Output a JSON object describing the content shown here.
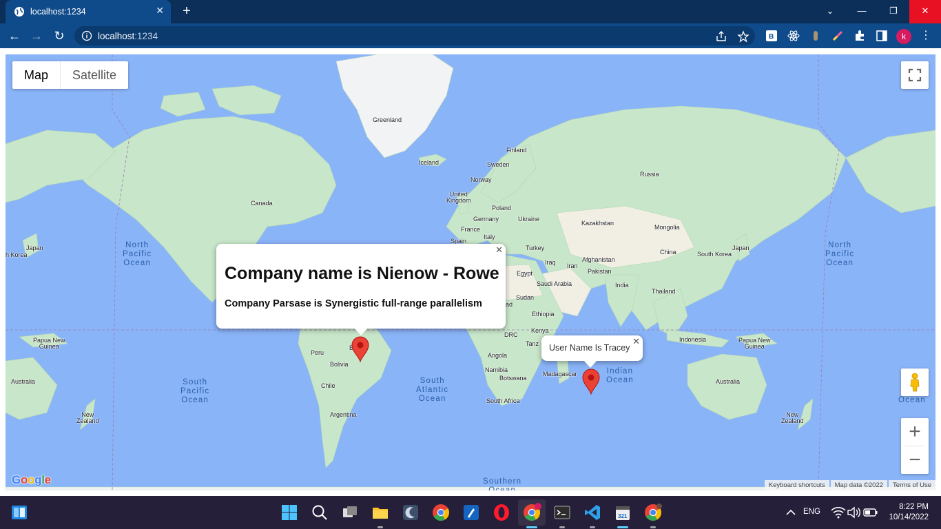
{
  "browser": {
    "tab_title": "localhost:1234",
    "url_host": "localhost",
    "url_port": ":1234",
    "profile_initial": "k"
  },
  "map": {
    "map_type_options": [
      "Map",
      "Satellite"
    ],
    "selected_map_type": "Map",
    "google_logo": "Google",
    "attribution": {
      "keyboard_shortcuts": "Keyboard shortcuts",
      "map_data": "Map data ©2022",
      "terms": "Terms of Use"
    },
    "labels": {
      "greenland": "Greenland",
      "iceland": "Iceland",
      "finland": "Finland",
      "sweden": "Sweden",
      "norway": "Norway",
      "russia": "Russia",
      "canada": "Canada",
      "united_kingdom": "United\nKingdom",
      "poland": "Poland",
      "germany": "Germany",
      "ukraine": "Ukraine",
      "france": "France",
      "italy": "Italy",
      "spain": "Spain",
      "kazakhstan": "Kazakhstan",
      "mongolia": "Mongolia",
      "turkey": "Turkey",
      "china": "China",
      "iraq": "Iraq",
      "iran": "Iran",
      "afghanistan": "Afghanistan",
      "pakistan": "Pakistan",
      "japan_left": "Japan",
      "japan_right": "Japan",
      "south_korea_left": "h Korea",
      "south_korea_right": "South Korea",
      "egypt": "Egypt",
      "saudi_arabia": "Saudi Arabia",
      "india": "India",
      "thailand": "Thailand",
      "sudan": "Sudan",
      "sudan_partial": "ad",
      "ethiopia": "Ethiopia",
      "kenya": "Kenya",
      "tanzania_partial": "Tanz",
      "drc": "DRC",
      "indonesia": "Indonesia",
      "papua_left": "Papua New\nGuinea",
      "papua_right": "Papua New\nGuinea",
      "peru": "Peru",
      "brazil_partial": "B",
      "bolivia": "Bolivia",
      "angola": "Angola",
      "namibia": "Namibia",
      "botswana": "Botswana",
      "madagascar": "Madagascar",
      "chile": "Chile",
      "south_africa": "South Africa",
      "argentina": "Argentina",
      "australia_left": "Australia",
      "australia_right": "Australia",
      "nz_left": "New\nZealand",
      "nz_right": "New\nZealand"
    },
    "oceans": {
      "north_pacific_left": "North\nPacific\nOcean",
      "north_pacific_right": "North\nPacific\nOcean",
      "south_pacific_left": "South\nPacific\nOcean",
      "south_pacific_right": "So\nPac\nOcean",
      "south_atlantic": "South\nAtlantic\nOcean",
      "indian": "Indian\nOcean",
      "southern": "Southern\nOcean"
    },
    "info_windows": [
      {
        "heading": "Company name is Nienow - Rowe",
        "body": "Company Parsase is Synergistic full-range parallelism"
      },
      {
        "body": "User Name Is Tracey"
      }
    ],
    "marker_color": "#ea4335",
    "water_color": "#8ab4f8",
    "land_color": "#c8e6c9"
  },
  "taskbar": {
    "language": "ENG",
    "time": "8:22 PM",
    "date": "10/14/2022"
  }
}
